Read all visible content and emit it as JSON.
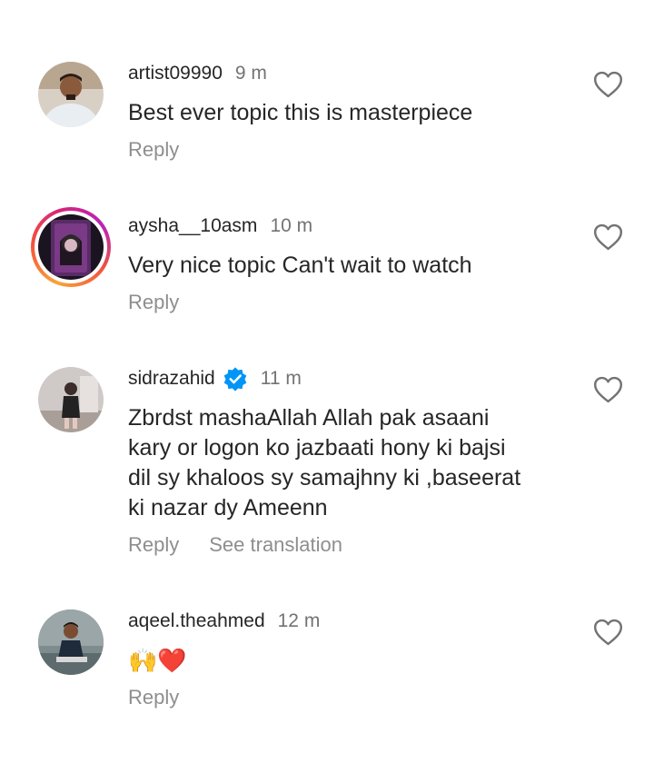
{
  "comments": [
    {
      "username": "artist09990",
      "time": "9 m",
      "text": "Best ever topic this is masterpiece",
      "reply_label": "Reply"
    },
    {
      "username": "aysha__10asm",
      "time": "10 m",
      "text": "Very nice topic Can't wait to watch",
      "reply_label": "Reply"
    },
    {
      "username": "sidrazahid",
      "time": "11 m",
      "text": "Zbrdst mashaAllah Allah pak  asaani\nkary or logon ko jazbaati hony ki bajsi\ndil sy khaloos sy samajhny ki ,baseerat\nki nazar dy Ameenn",
      "reply_label": "Reply",
      "translation_label": "See translation"
    },
    {
      "username": "aqeel.theahmed",
      "time": "12 m",
      "text": "🙌❤️",
      "reply_label": "Reply"
    }
  ],
  "icons": {
    "like": "heart-outline-icon",
    "verified": "verified-badge-icon"
  },
  "colors": {
    "text": "#262626",
    "secondary": "#8e8e8e",
    "verified": "#0095f6"
  }
}
